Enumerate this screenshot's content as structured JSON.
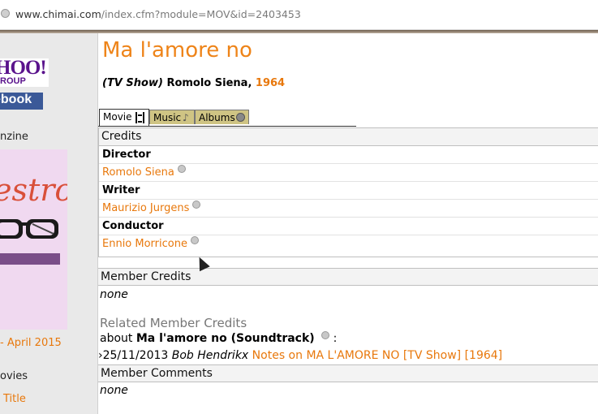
{
  "browser": {
    "url_host": "www.chimai.com",
    "url_path": "/index.cfm?module=MOV&id=2403453"
  },
  "sidebar": {
    "yahoo_top": "HOO!",
    "yahoo_bottom": "ROUP",
    "facebook": "ebook",
    "magazine_label": "nzine",
    "magazine_cover_script": "estro",
    "magazine_issue_link": "- April 2015",
    "movies_label": "ovies",
    "title_link": "Title"
  },
  "page": {
    "title": "Ma l'amore no",
    "type_label": "(TV Show)",
    "director_name": "Romolo Siena",
    "year": "1964"
  },
  "tabs": [
    {
      "label": "Movie",
      "icon": "film-icon"
    },
    {
      "label": "Music",
      "icon": "music-note-icon"
    },
    {
      "label": "Albums",
      "icon": "disc-icon"
    }
  ],
  "credits": {
    "heading": "Credits",
    "roles": [
      {
        "role": "Director",
        "person": "Romolo Siena"
      },
      {
        "role": "Writer",
        "person": "Maurizio Jurgens"
      },
      {
        "role": "Conductor",
        "person": "Ennio Morricone"
      }
    ]
  },
  "member_credits": {
    "heading": "Member Credits",
    "value": "none"
  },
  "related": {
    "heading": "Related Member Credits",
    "about_prefix": "about",
    "about_title": "Ma l'amore no (Soundtrack)",
    "about_suffix": ":",
    "entry_date": "25/11/2013",
    "entry_author": "Bob Hendrikx",
    "entry_link": "Notes on MA L'AMORE NO [TV Show] [1964]"
  },
  "member_comments": {
    "heading": "Member Comments",
    "value": "none"
  },
  "colors": {
    "accent_orange": "#ee8419",
    "tab_inactive": "#cfc484",
    "facebook_blue": "#3b5998",
    "yahoo_purple": "#5a138c"
  }
}
